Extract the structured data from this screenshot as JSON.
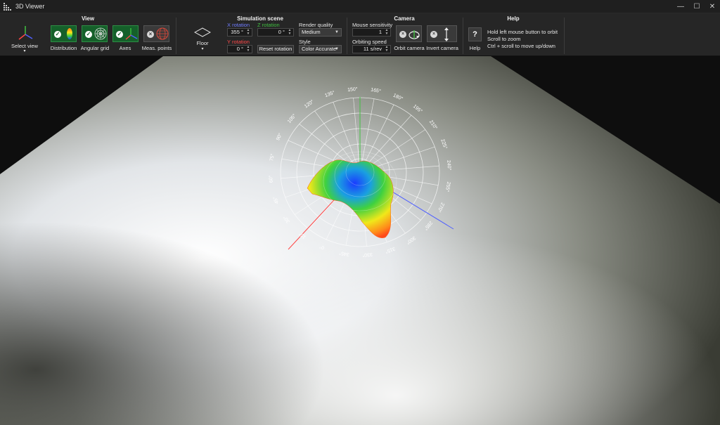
{
  "window": {
    "title": "3D Viewer",
    "controls": {
      "minimize": "—",
      "maximize": "☐",
      "close": "✕"
    }
  },
  "view": {
    "title": "View",
    "select_view_label": "Select view",
    "toggles": [
      {
        "label": "Distribution",
        "checked": true
      },
      {
        "label": "Angular grid",
        "checked": true
      },
      {
        "label": "Axes",
        "checked": true
      },
      {
        "label": "Meas. points",
        "checked": false
      }
    ]
  },
  "simulation": {
    "title": "Simulation scene",
    "floor_label": "Floor",
    "x_rotation": {
      "label": "X rotation",
      "value": "355 °",
      "color": "#6f7cff"
    },
    "z_rotation": {
      "label": "Z rotation",
      "value": "0 °",
      "color": "#3fbf3f"
    },
    "y_rotation": {
      "label": "Y rotation",
      "value": "0 °",
      "color": "#ff4a4a"
    },
    "reset_rotation_label": "Reset rotation",
    "render_quality": {
      "label": "Render quality",
      "value": "Medium"
    },
    "style": {
      "label": "Style",
      "value": "Color Accurate"
    }
  },
  "camera": {
    "title": "Camera",
    "mouse_sensitivity": {
      "label": "Mouse sensitivity",
      "value": "1"
    },
    "orbiting_speed": {
      "label": "Orbiting speed",
      "value": "11 s/rev"
    },
    "orbit_camera_label": "Orbit camera",
    "invert_camera_label": "Invert camera"
  },
  "help": {
    "title": "Help",
    "button_label": "Help",
    "button_glyph": "?",
    "lines": [
      "Hold left mouse button to orbit",
      "Scroll to zoom",
      "Ctrl + scroll to move up/down"
    ]
  },
  "scene": {
    "grid_angle_labels": [
      "0°",
      "15°",
      "30°",
      "45°",
      "60°",
      "75°",
      "90°",
      "105°",
      "120°",
      "135°",
      "150°",
      "165°",
      "180°",
      "195°",
      "210°",
      "225°",
      "240°",
      "255°",
      "270°",
      "285°",
      "300°",
      "315°",
      "330°",
      "345°"
    ],
    "colors": {
      "axis_x": "#ff4444",
      "axis_y": "#5060ff",
      "axis_z": "#40c040",
      "floor": "#c8ccc4"
    }
  }
}
